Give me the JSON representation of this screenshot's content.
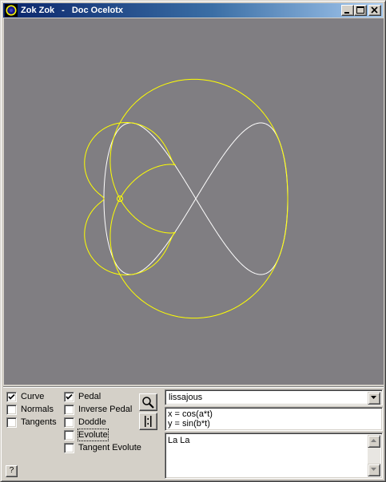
{
  "window": {
    "app_name": "Zok Zok",
    "separator": "-",
    "document_name": "Doc Ocelotx",
    "controls": [
      "minimize-icon",
      "maximize-icon",
      "close-icon"
    ]
  },
  "canvas": {
    "background": "#807e82",
    "curve_color": "#ffffff",
    "pedal_color": "#ffff00"
  },
  "options": {
    "column1": [
      {
        "label": "Curve",
        "checked": true
      },
      {
        "label": "Normals",
        "checked": false
      },
      {
        "label": "Tangents",
        "checked": false
      }
    ],
    "column2": [
      {
        "label": "Pedal",
        "checked": true
      },
      {
        "label": "Inverse Pedal",
        "checked": false
      },
      {
        "label": "Doddle",
        "checked": false
      },
      {
        "label": "Evolute",
        "checked": false
      },
      {
        "label": "Tangent Evolute",
        "checked": false
      }
    ]
  },
  "tools": {
    "zoom_icon": "magnifier-icon",
    "center_icon": "split-center-icon"
  },
  "help_label": "?",
  "curve_select": {
    "value": "lissajous"
  },
  "formula": {
    "line1": "x = cos(a*t)",
    "line2": "y = sin(b*t)"
  },
  "notes": {
    "text": "La La"
  }
}
